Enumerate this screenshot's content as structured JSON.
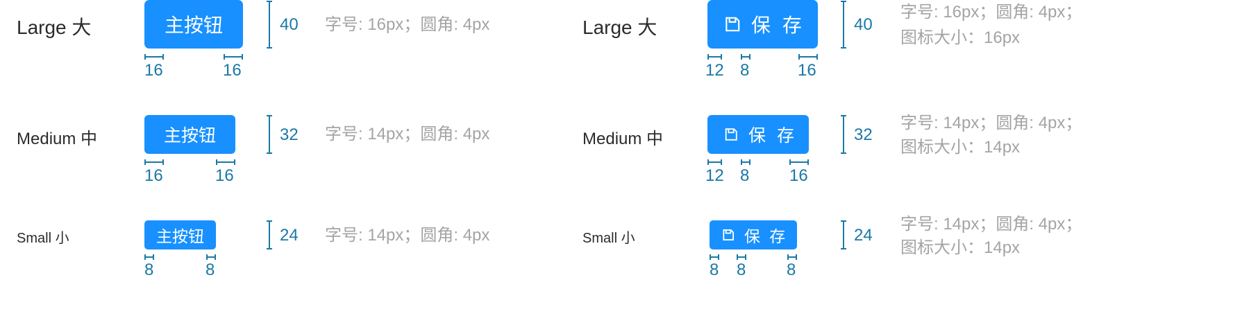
{
  "rows": {
    "large": {
      "label": "Large 大",
      "button_text": "主按钮",
      "icon_button_text": "保 存",
      "height": "40",
      "spec_left": "字号: 16px；圆角: 4px",
      "spec_right_1": "字号: 16px；圆角: 4px；",
      "spec_right_2": "图标大小：16px",
      "pad_left": "16",
      "pad_right": "16",
      "icon_pad_left": "12",
      "icon_gap": "8",
      "icon_pad_right": "16"
    },
    "medium": {
      "label": "Medium 中",
      "button_text": "主按钮",
      "icon_button_text": "保 存",
      "height": "32",
      "spec_left": "字号: 14px；圆角: 4px",
      "spec_right_1": "字号: 14px；圆角: 4px；",
      "spec_right_2": "图标大小：14px",
      "pad_left": "16",
      "pad_right": "16",
      "icon_pad_left": "12",
      "icon_gap": "8",
      "icon_pad_right": "16"
    },
    "small": {
      "label": "Small 小",
      "button_text": "主按钮",
      "icon_button_text": "保 存",
      "height": "24",
      "spec_left": "字号: 14px；圆角: 4px",
      "spec_right_1": "字号: 14px；圆角: 4px；",
      "spec_right_2": "图标大小：14px",
      "pad_left": "8",
      "pad_right": "8",
      "icon_pad_left": "8",
      "icon_gap": "8",
      "icon_pad_right": "8"
    }
  },
  "icon_name": "save-icon",
  "colors": {
    "primary": "#1890ff",
    "dimension": "#1a78a6",
    "spec_text": "#a4a4a4",
    "label_text": "#2b2b2b"
  }
}
